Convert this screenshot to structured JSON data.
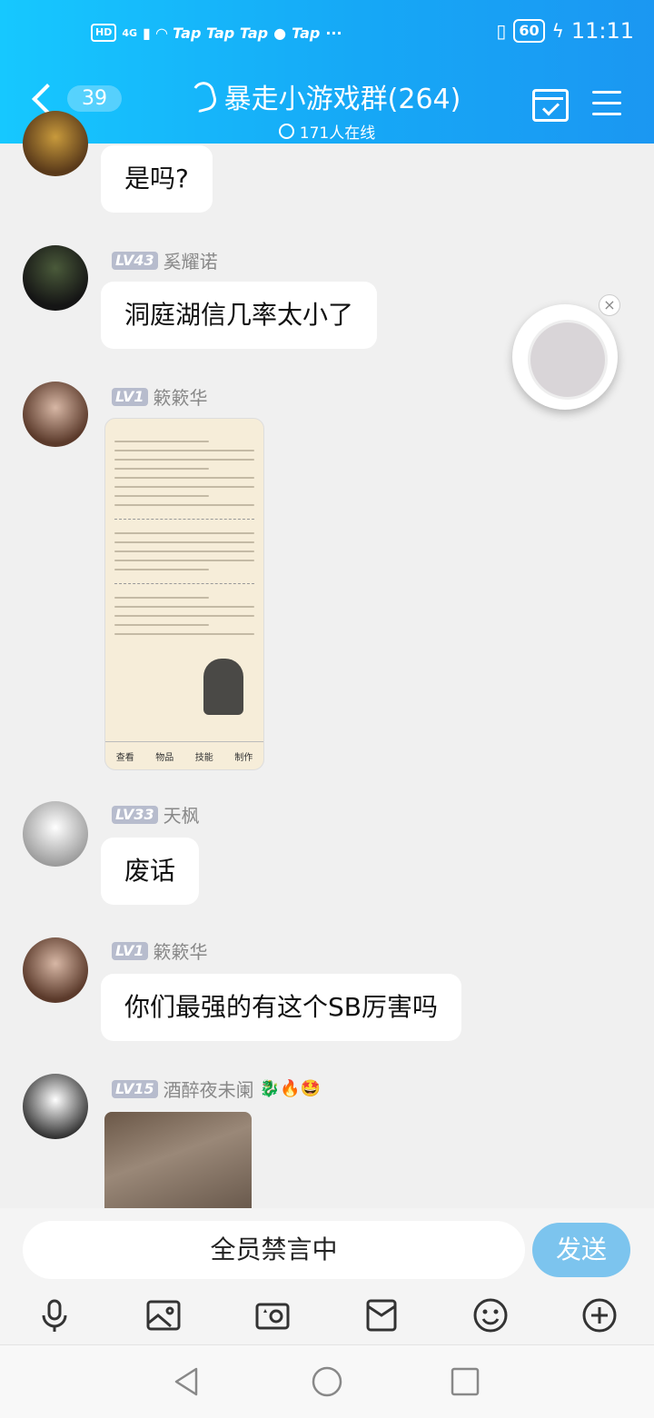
{
  "status_bar": {
    "network": "4G",
    "hd": "HD",
    "apps": "Tap Tap Tap",
    "apps2": "Tap",
    "dots": "···",
    "battery": "60",
    "time": "11:11"
  },
  "header": {
    "unread": "39",
    "title": "暴走小游戏群(264)",
    "online": "171人在线"
  },
  "messages": [
    {
      "text": "是吗?"
    },
    {
      "level": "LV43",
      "name": "奚耀诺",
      "text": "洞庭湖信几率太小了"
    },
    {
      "level": "LV1",
      "name": "簌簌华",
      "image": "character-stats-screenshot"
    },
    {
      "level": "LV33",
      "name": "天枫",
      "text": "废话"
    },
    {
      "level": "LV1",
      "name": "簌簌华",
      "text": "你们最强的有这个SB厉害吗"
    },
    {
      "level": "LV15",
      "name": "酒醉夜未阑",
      "badges": "🐉🔥🤩",
      "image": "cat-gif"
    }
  ],
  "image_card": {
    "tabs": [
      "查看",
      "物品",
      "技能",
      "制作"
    ]
  },
  "input": {
    "muted_text": "全员禁言中",
    "send": "发送"
  },
  "toolbar": [
    "mic-icon",
    "image-icon",
    "camera-icon",
    "red-packet-icon",
    "emoji-icon",
    "plus-icon"
  ],
  "colors": {
    "header_start": "#16c8ff",
    "header_end": "#1b97f2",
    "send_button": "#7cc4ee",
    "level_badge": "#b7bccd"
  }
}
